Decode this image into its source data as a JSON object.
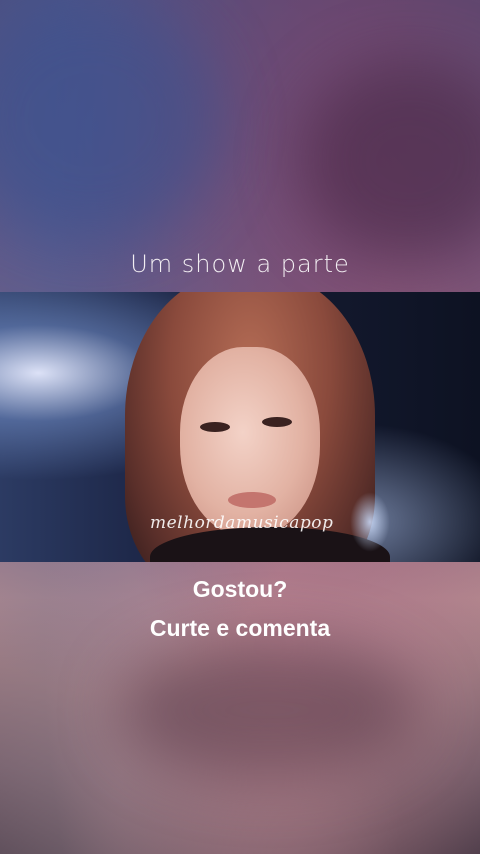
{
  "post": {
    "caption_top": "Um show a parte",
    "watermark": "melhordamusicapop",
    "caption_line1": "Gostou?",
    "caption_line2": "Curte e comenta"
  }
}
